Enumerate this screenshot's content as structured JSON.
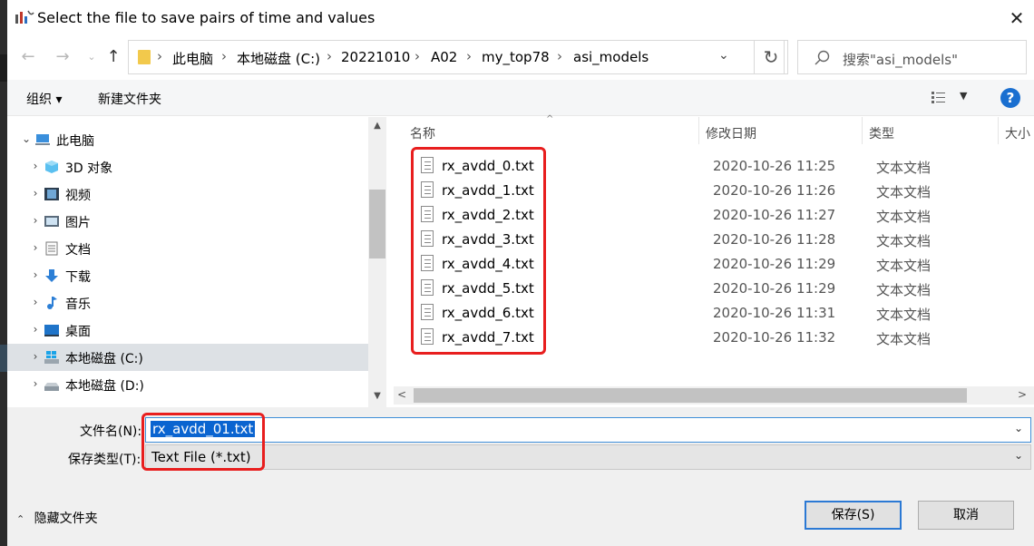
{
  "window": {
    "title": "Select the file to save pairs of time and values",
    "close_symbol": "✕"
  },
  "nav": {
    "back_icon": "back-arrow-icon",
    "forward_icon": "forward-arrow-icon",
    "up_icon": "up-arrow-icon"
  },
  "address": {
    "crumbs": [
      "此电脑",
      "本地磁盘 (C:)",
      "20221010",
      "A02",
      "my_top78",
      "asi_models"
    ]
  },
  "search": {
    "placeholder": "搜索\"asi_models\""
  },
  "toolbar": {
    "organize": "组织 ▾",
    "new_folder": "新建文件夹",
    "help": "?"
  },
  "tree": [
    {
      "label": "此电脑",
      "icon": "computer-icon",
      "arrow": "⌄",
      "indent": 0
    },
    {
      "label": "3D 对象",
      "icon": "cube-3d-icon",
      "arrow": "›",
      "indent": 1
    },
    {
      "label": "视频",
      "icon": "video-icon",
      "arrow": "›",
      "indent": 1
    },
    {
      "label": "图片",
      "icon": "picture-icon",
      "arrow": "›",
      "indent": 1
    },
    {
      "label": "文档",
      "icon": "document-icon",
      "arrow": "›",
      "indent": 1
    },
    {
      "label": "下载",
      "icon": "download-icon",
      "arrow": "›",
      "indent": 1
    },
    {
      "label": "音乐",
      "icon": "music-icon",
      "arrow": "›",
      "indent": 1
    },
    {
      "label": "桌面",
      "icon": "desktop-icon",
      "arrow": "›",
      "indent": 1
    },
    {
      "label": "本地磁盘 (C:)",
      "icon": "windows-drive-icon",
      "arrow": "›",
      "indent": 1,
      "selected": true
    },
    {
      "label": "本地磁盘 (D:)",
      "icon": "drive-icon",
      "arrow": "›",
      "indent": 1
    }
  ],
  "columns": {
    "name": "名称",
    "date": "修改日期",
    "type": "类型",
    "size": "大小"
  },
  "files": [
    {
      "name": "rx_avdd_0.txt",
      "date": "2020-10-26 11:25",
      "type": "文本文档"
    },
    {
      "name": "rx_avdd_1.txt",
      "date": "2020-10-26 11:26",
      "type": "文本文档"
    },
    {
      "name": "rx_avdd_2.txt",
      "date": "2020-10-26 11:27",
      "type": "文本文档"
    },
    {
      "name": "rx_avdd_3.txt",
      "date": "2020-10-26 11:28",
      "type": "文本文档"
    },
    {
      "name": "rx_avdd_4.txt",
      "date": "2020-10-26 11:29",
      "type": "文本文档"
    },
    {
      "name": "rx_avdd_5.txt",
      "date": "2020-10-26 11:29",
      "type": "文本文档"
    },
    {
      "name": "rx_avdd_6.txt",
      "date": "2020-10-26 11:31",
      "type": "文本文档"
    },
    {
      "name": "rx_avdd_7.txt",
      "date": "2020-10-26 11:32",
      "type": "文本文档"
    }
  ],
  "save_form": {
    "filename_label": "文件名(N):",
    "filename_value": "rx_avdd_01.txt",
    "filetype_label": "保存类型(T):",
    "filetype_value": "Text File (*.txt)"
  },
  "footer": {
    "hide_folders": "隐藏文件夹",
    "save": "保存(S)",
    "cancel": "取消"
  },
  "colors": {
    "highlight_red": "#e81e1e",
    "selection_blue": "#0a64d0",
    "help_blue": "#1a6fd0"
  }
}
